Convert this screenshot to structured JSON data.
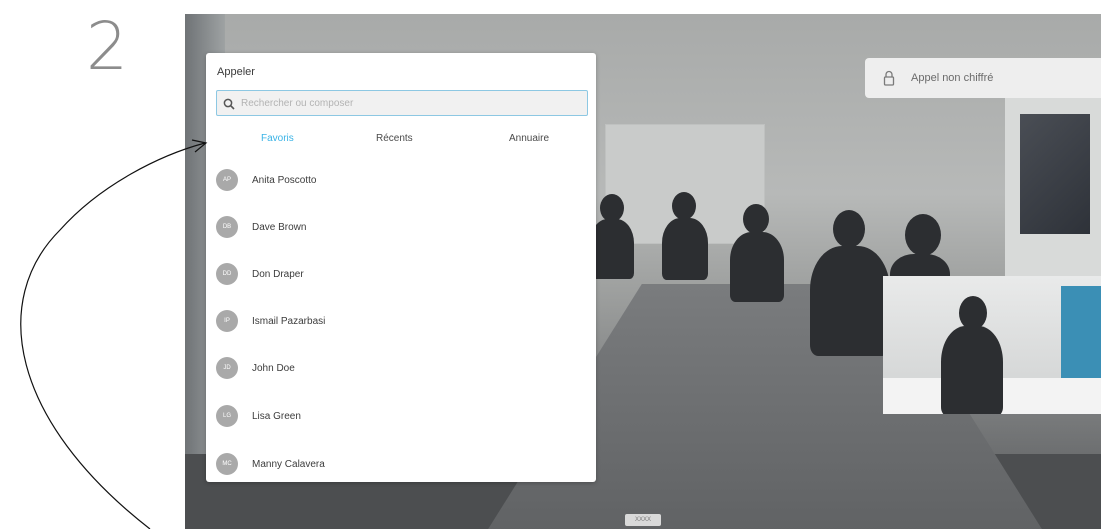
{
  "step": {
    "number": "2"
  },
  "call_panel": {
    "title": "Appeler",
    "search": {
      "placeholder": "Rechercher ou composer",
      "value": ""
    },
    "tabs": [
      {
        "label": "Favoris",
        "active": true
      },
      {
        "label": "Récents",
        "active": false
      },
      {
        "label": "Annuaire",
        "active": false
      }
    ],
    "contacts": [
      {
        "name": "Anita Poscotto",
        "initials": "AP"
      },
      {
        "name": "Dave Brown",
        "initials": "DB"
      },
      {
        "name": "Don Draper",
        "initials": "DD"
      },
      {
        "name": "Ismail Pazarbasi",
        "initials": "IP"
      },
      {
        "name": "John Doe",
        "initials": "JD"
      },
      {
        "name": "Lisa Green",
        "initials": "LG"
      },
      {
        "name": "Manny Calavera",
        "initials": "MC"
      }
    ]
  },
  "status": {
    "encryption": "Appel non chiffré"
  },
  "video": {
    "bottom_label": "XXXX"
  },
  "colors": {
    "accent": "#3ab3e6",
    "search_border": "#8dc8e3",
    "avatar": "#a9a9a9"
  },
  "icons": {
    "search": "search-icon",
    "lock": "lock-icon"
  }
}
